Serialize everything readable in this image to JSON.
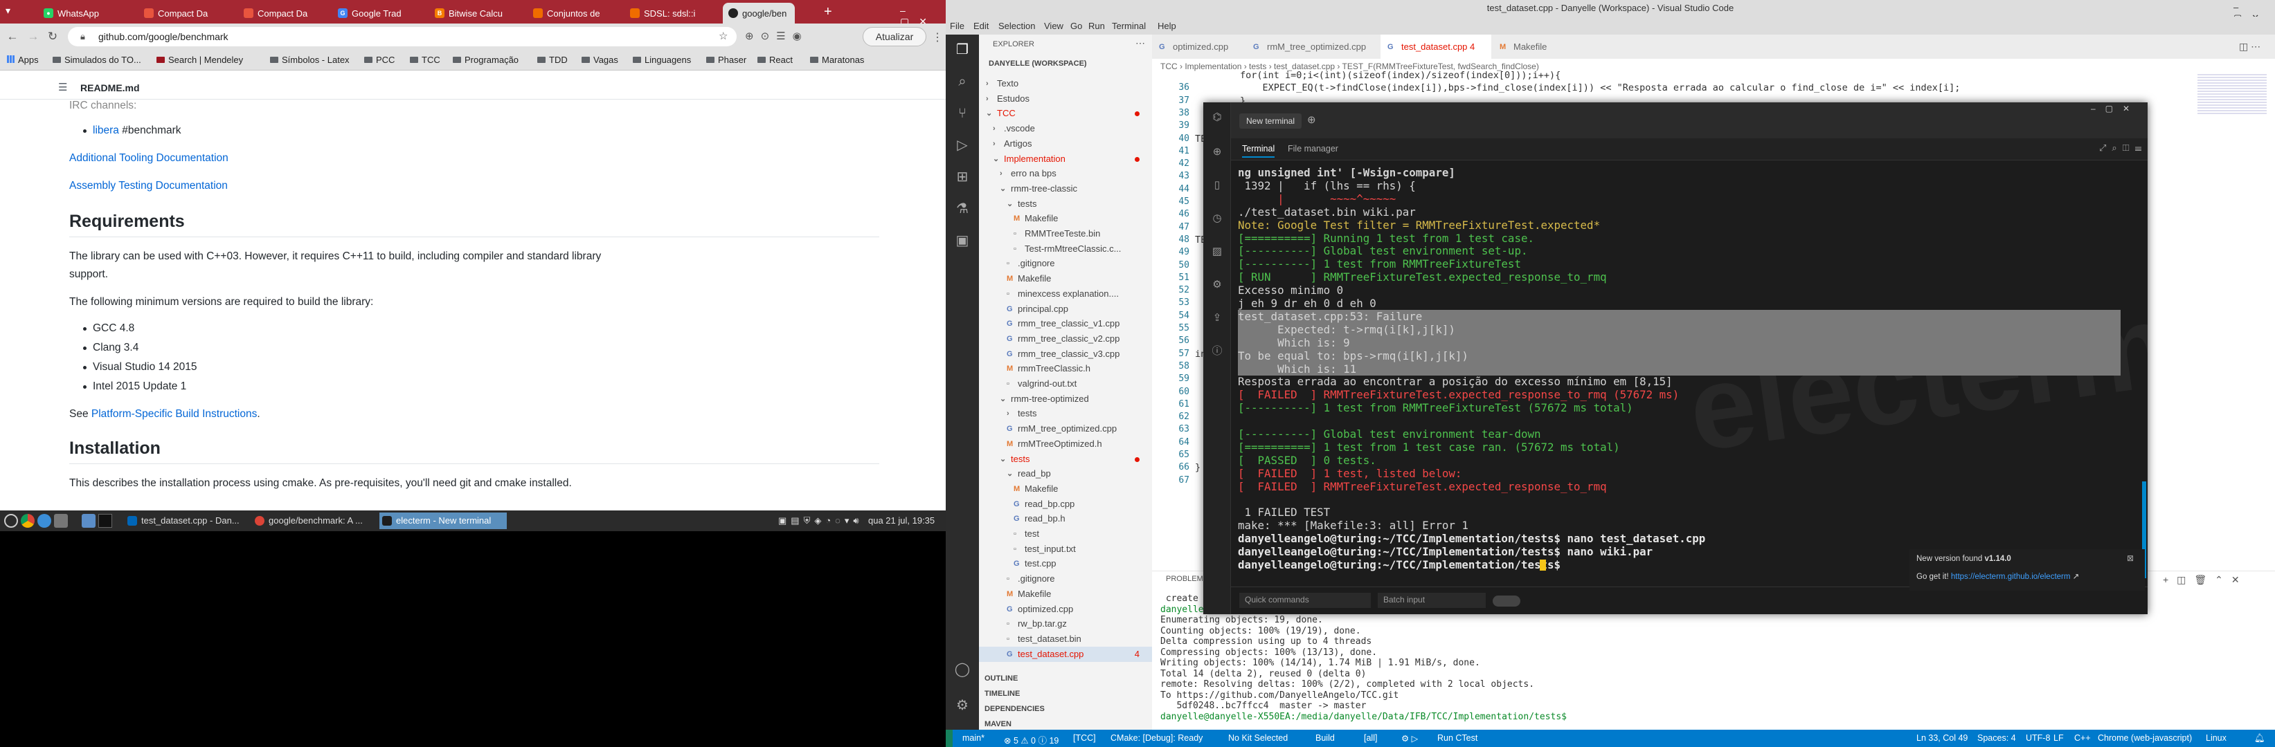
{
  "chrome": {
    "tabs": [
      "WhatsApp",
      "Compact Da",
      "Compact Da",
      "Google Trad",
      "Bitwise Calcu",
      "Conjuntos de",
      "SDSL: sdsl::i",
      "google/ben"
    ],
    "url": "github.com/google/benchmark",
    "update_label": "Atualizar",
    "bookmarks": [
      "Apps",
      "Simulados do TO...",
      "Search | Mendeley",
      "Símbolos - Latex",
      "PCC",
      "TCC",
      "Programação",
      "TDD",
      "Vagas",
      "Linguagens",
      "Phaser",
      "React",
      "Maratonas"
    ],
    "readme_title": "README.md",
    "readme": {
      "irc": "IRC channels:",
      "libera": "libera",
      "libera_suffix": " #benchmark",
      "tooling_link": "Additional Tooling Documentation",
      "assembly_link": "Assembly Testing Documentation",
      "req_heading": "Requirements",
      "req_p1a": "The library can be used with C++03. However, it requires C++11 to build, including compiler and standard library",
      "req_p1b": "support.",
      "req_p2": "The following minimum versions are required to build the library:",
      "versions": [
        "GCC 4.8",
        "Clang 3.4",
        "Visual Studio 14 2015",
        "Intel 2015 Update 1"
      ],
      "see": "See ",
      "platform_link": "Platform-Specific Build Instructions",
      "platform_suffix": ".",
      "install_heading": "Installation",
      "install_p": "This describes the installation process using cmake. As pre-requisites, you'll need git and cmake installed."
    }
  },
  "taskbar": {
    "tasks": [
      "test_dataset.cpp - Dan...",
      "google/benchmark: A ...",
      "electerm - New terminal"
    ],
    "clock": "qua 21 jul, 19:35"
  },
  "vscode": {
    "window_title": "test_dataset.cpp - Danyelle (Workspace) - Visual Studio Code",
    "menu": [
      "File",
      "Edit",
      "Selection",
      "View",
      "Go",
      "Run",
      "Terminal",
      "Help"
    ],
    "explorer_title": "EXPLORER",
    "workspace": "DANYELLE (WORKSPACE)",
    "tree": [
      {
        "label": "Texto",
        "indent": 1,
        "kind": "folder-closed"
      },
      {
        "label": "Estudos",
        "indent": 1,
        "kind": "folder-closed"
      },
      {
        "label": "TCC",
        "indent": 1,
        "kind": "folder-open",
        "red": true,
        "dot": true
      },
      {
        "label": ".vscode",
        "indent": 2,
        "kind": "folder-closed"
      },
      {
        "label": "Artigos",
        "indent": 2,
        "kind": "folder-closed"
      },
      {
        "label": "Implementation",
        "indent": 2,
        "kind": "folder-open",
        "red": true,
        "dot": true
      },
      {
        "label": "erro na bps",
        "indent": 3,
        "kind": "folder-closed"
      },
      {
        "label": "rmm-tree-classic",
        "indent": 3,
        "kind": "folder-open"
      },
      {
        "label": "tests",
        "indent": 4,
        "kind": "folder-open"
      },
      {
        "label": "Makefile",
        "indent": 5,
        "kind": "file-m"
      },
      {
        "label": "RMMTreeTeste.bin",
        "indent": 5,
        "kind": "file"
      },
      {
        "label": "Test-rmMtreeClassic.c...",
        "indent": 5,
        "kind": "file"
      },
      {
        "label": ".gitignore",
        "indent": 4,
        "kind": "file"
      },
      {
        "label": "Makefile",
        "indent": 4,
        "kind": "file-m"
      },
      {
        "label": "minexcess explanation....",
        "indent": 4,
        "kind": "file"
      },
      {
        "label": "principal.cpp",
        "indent": 4,
        "kind": "file-c"
      },
      {
        "label": "rmm_tree_classic_v1.cpp",
        "indent": 4,
        "kind": "file-c"
      },
      {
        "label": "rmm_tree_classic_v2.cpp",
        "indent": 4,
        "kind": "file-c"
      },
      {
        "label": "rmm_tree_classic_v3.cpp",
        "indent": 4,
        "kind": "file-c"
      },
      {
        "label": "rmmTreeClassic.h",
        "indent": 4,
        "kind": "file-m"
      },
      {
        "label": "valgrind-out.txt",
        "indent": 4,
        "kind": "file"
      },
      {
        "label": "rmm-tree-optimized",
        "indent": 3,
        "kind": "folder-open"
      },
      {
        "label": "tests",
        "indent": 4,
        "kind": "folder-closed"
      },
      {
        "label": "rmM_tree_optimized.cpp",
        "indent": 4,
        "kind": "file-c"
      },
      {
        "label": "rmMTreeOptimized.h",
        "indent": 4,
        "kind": "file-m"
      },
      {
        "label": "tests",
        "indent": 3,
        "kind": "folder-open",
        "red": true,
        "dot": true
      },
      {
        "label": "read_bp",
        "indent": 4,
        "kind": "folder-open"
      },
      {
        "label": "Makefile",
        "indent": 5,
        "kind": "file-m"
      },
      {
        "label": "read_bp.cpp",
        "indent": 5,
        "kind": "file-c"
      },
      {
        "label": "read_bp.h",
        "indent": 5,
        "kind": "file-c"
      },
      {
        "label": "test",
        "indent": 5,
        "kind": "file"
      },
      {
        "label": "test_input.txt",
        "indent": 5,
        "kind": "file"
      },
      {
        "label": "test.cpp",
        "indent": 5,
        "kind": "file-c"
      },
      {
        "label": ".gitignore",
        "indent": 4,
        "kind": "file"
      },
      {
        "label": "Makefile",
        "indent": 4,
        "kind": "file-m"
      },
      {
        "label": "optimized.cpp",
        "indent": 4,
        "kind": "file-c"
      },
      {
        "label": "rw_bp.tar.gz",
        "indent": 4,
        "kind": "file"
      },
      {
        "label": "test_dataset.bin",
        "indent": 4,
        "kind": "file"
      },
      {
        "label": "test_dataset.cpp",
        "indent": 4,
        "kind": "file-c",
        "red": true,
        "badge": "4",
        "selected": true
      }
    ],
    "sections": [
      "OUTLINE",
      "TIMELINE",
      "DEPENDENCIES",
      "MAVEN"
    ],
    "tabs": [
      "optimized.cpp",
      "rmM_tree_optimized.cpp",
      "test_dataset.cpp 4",
      "Makefile"
    ],
    "breadcrumbs": "TCC  ›  Implementation  ›  tests  ›  test_dataset.cpp  ›  TEST_F(RMMTreeFixtureTest, fwdSearch_findClose)",
    "code": [
      {
        "n": "",
        "t": "        for(int i=0;i<(int)(sizeof(index)/sizeof(index[0]));i++){"
      },
      {
        "n": "36",
        "t": "            EXPECT_EQ(t->findClose(index[i]),bps->find_close(index[i])) << \"Resposta errada ao calcular o find_close de i=\" << index[i];"
      },
      {
        "n": "37",
        "t": "        }"
      },
      {
        "n": "38",
        "t": "    }"
      },
      {
        "n": "39",
        "t": ""
      },
      {
        "n": "40",
        "t": "TEST_"
      },
      {
        "n": "41",
        "t": "    in"
      },
      {
        "n": "42",
        "t": ""
      },
      {
        "n": "43",
        "t": "        r"
      },
      {
        "n": "44",
        "t": ""
      },
      {
        "n": "45",
        "t": "        }"
      },
      {
        "n": "46",
        "t": "    }"
      },
      {
        "n": "47",
        "t": ""
      },
      {
        "n": "48",
        "t": "TEST_"
      },
      {
        "n": "49",
        "t": "    i"
      },
      {
        "n": "50",
        "t": "    i"
      },
      {
        "n": "51",
        "t": ""
      },
      {
        "n": "52",
        "t": "        f"
      },
      {
        "n": "53",
        "t": ""
      },
      {
        "n": "54",
        "t": "        }"
      },
      {
        "n": "55",
        "t": "    }"
      },
      {
        "n": "56",
        "t": ""
      },
      {
        "n": "57",
        "t": "int m"
      },
      {
        "n": "58",
        "t": ""
      },
      {
        "n": "59",
        "t": "        i"
      },
      {
        "n": "60",
        "t": ""
      },
      {
        "n": "61",
        "t": "    }"
      },
      {
        "n": "62",
        "t": "    p"
      },
      {
        "n": "63",
        "t": "    i"
      },
      {
        "n": "64",
        "t": "    t"
      },
      {
        "n": "65",
        "t": "    r"
      },
      {
        "n": "66",
        "t": "}"
      },
      {
        "n": "67",
        "t": ""
      }
    ],
    "panel_tab": "PROBLEMS",
    "panel_badge": "24",
    "panel_lines": [
      " create mode",
      "danyelle@danyelle-X550EA:/media/danyelle/Data/IFB/TCC/Implementation/tests$ git push",
      "Enumerating objects: 19, done.",
      "Counting objects: 100% (19/19), done.",
      "Delta compression using up to 4 threads",
      "Compressing objects: 100% (13/13), done.",
      "Writing objects: 100% (14/14), 1.74 MiB | 1.91 MiB/s, done.",
      "Total 14 (delta 2), reused 0 (delta 0)",
      "remote: Resolving deltas: 100% (2/2), completed with 2 local objects.",
      "To https://github.com/DanyelleAngelo/TCC.git",
      "   5df0248..bc7ffcc4  master -> master",
      "danyelle@danyelle-X550EA:/media/danyelle/Data/IFB/TCC/Implementation/tests$ "
    ],
    "status": {
      "branch": "main*",
      "errors": "⊗ 5 ⚠ 0 ⓘ 19",
      "tcc": "[TCC]",
      "cmake": "CMake: [Debug]: Ready",
      "kit": "No Kit Selected",
      "build": "Build",
      "all": "[all]",
      "run_ctest": "Run CTest",
      "ln_col": "Ln 33, Col 49",
      "spaces": "Spaces: 4",
      "encoding": "UTF-8",
      "eol": "LF",
      "lang": "C++",
      "debugger": "Chrome (web-javascript)",
      "os": "Linux"
    }
  },
  "electerm": {
    "new_tab": "New terminal",
    "tab_terminal": "Terminal",
    "tab_files": "File manager",
    "watermark": "electerm",
    "lines": [
      {
        "t": "ng unsigned int' [-Wsign-compare]",
        "c": "bold"
      },
      {
        "t": " 1392 |   if (lhs == rhs) {",
        "c": ""
      },
      {
        "t": "      |       ~~~~^~~~~~",
        "c": "rd"
      },
      {
        "t": "./test_dataset.bin wiki.par",
        "c": ""
      },
      {
        "t": "Note: Google Test filter = RMMTreeFixtureTest.expected*",
        "c": "yl"
      },
      {
        "t": "[==========] Running 1 test from 1 test case.",
        "c": "gr"
      },
      {
        "t": "[----------] Global test environment set-up.",
        "c": "gr"
      },
      {
        "t": "[----------] 1 test from RMMTreeFixtureTest",
        "c": "gr"
      },
      {
        "t": "[ RUN      ] RMMTreeFixtureTest.expected_response_to_rmq",
        "c": "gr"
      },
      {
        "t": "Excesso minimo 0",
        "c": ""
      },
      {
        "t": "j eh 9 dr eh 0 d eh 0",
        "c": ""
      },
      {
        "t": "test_dataset.cpp:53: Failure",
        "c": "sel"
      },
      {
        "t": "      Expected: t->rmq(i[k],j[k])",
        "c": "sel"
      },
      {
        "t": "      Which is: 9",
        "c": "sel"
      },
      {
        "t": "To be equal to: bps->rmq(i[k],j[k])",
        "c": "sel"
      },
      {
        "t": "      Which is: 11",
        "c": "sel"
      },
      {
        "t": "Resposta errada ao encontrar a posição do excesso mínimo em [8,15]",
        "c": ""
      },
      {
        "t": "[  FAILED  ] RMMTreeFixtureTest.expected_response_to_rmq (57672 ms)",
        "c": "rd"
      },
      {
        "t": "[----------] 1 test from RMMTreeFixtureTest (57672 ms total)",
        "c": "gr"
      },
      {
        "t": "",
        "c": ""
      },
      {
        "t": "[----------] Global test environment tear-down",
        "c": "gr"
      },
      {
        "t": "[==========] 1 test from 1 test case ran. (57672 ms total)",
        "c": "gr"
      },
      {
        "t": "[  PASSED  ] 0 tests.",
        "c": "gr"
      },
      {
        "t": "[  FAILED  ] 1 test, listed below:",
        "c": "rd"
      },
      {
        "t": "[  FAILED  ] RMMTreeFixtureTest.expected_response_to_rmq",
        "c": "rd"
      },
      {
        "t": "",
        "c": ""
      },
      {
        "t": " 1 FAILED TEST",
        "c": ""
      },
      {
        "t": "make: *** [Makefile:3: all] Error 1",
        "c": ""
      },
      {
        "t": "danyelleangelo@turing:~/TCC/Implementation/tests$ nano test_dataset.cpp",
        "c": "prompt"
      },
      {
        "t": "danyelleangelo@turing:~/TCC/Implementation/tests$ nano wiki.par",
        "c": "prompt"
      },
      {
        "t": "danyelleangelo@turing:~/TCC/Implementation/tests$ ",
        "c": "prompt"
      }
    ],
    "quick_commands": "Quick commands",
    "batch_input": "Batch input",
    "new_version": "New version found",
    "version": "v1.14.0",
    "goto_label": "Go get it!",
    "goto_link": "https://electerm.github.io/electerm"
  }
}
